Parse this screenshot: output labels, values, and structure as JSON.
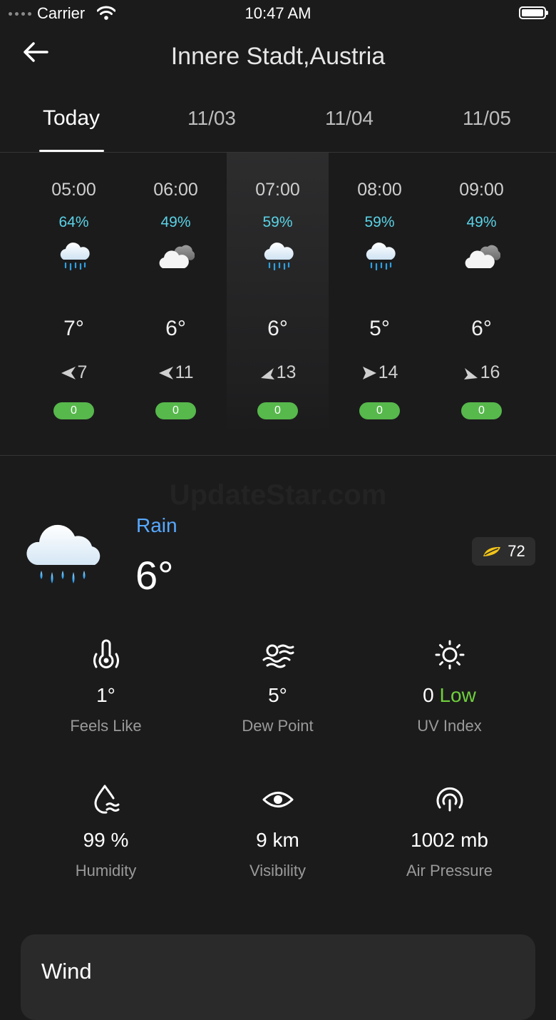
{
  "status_bar": {
    "carrier": "Carrier",
    "time": "10:47 AM"
  },
  "header": {
    "title": "Innere Stadt,Austria"
  },
  "tabs": [
    {
      "label": "Today",
      "active": true
    },
    {
      "label": "11/03"
    },
    {
      "label": "11/04"
    },
    {
      "label": "11/05"
    }
  ],
  "hourly": [
    {
      "time": "05:00",
      "precip": "64%",
      "icon": "rain-cloud-icon",
      "temp": "7°",
      "wind_dir": "west",
      "wind_speed": "7",
      "aqi": "0"
    },
    {
      "time": "06:00",
      "precip": "49%",
      "icon": "overcast-cloud-icon",
      "temp": "6°",
      "wind_dir": "west",
      "wind_speed": "11",
      "aqi": "0"
    },
    {
      "time": "07:00",
      "precip": "59%",
      "icon": "rain-cloud-icon",
      "temp": "6°",
      "wind_dir": "north-west",
      "wind_speed": "13",
      "aqi": "0",
      "selected": true
    },
    {
      "time": "08:00",
      "precip": "59%",
      "icon": "rain-cloud-icon",
      "temp": "5°",
      "wind_dir": "east",
      "wind_speed": "14",
      "aqi": "0"
    },
    {
      "time": "09:00",
      "precip": "49%",
      "icon": "overcast-cloud-icon",
      "temp": "6°",
      "wind_dir": "south-east",
      "wind_speed": "16",
      "aqi": "0"
    }
  ],
  "watermark": "UpdateStar.com",
  "current": {
    "condition": "Rain",
    "temp": "6°",
    "aqi": "72"
  },
  "details": {
    "feels_like": {
      "value": "1°",
      "label": "Feels Like"
    },
    "dew_point": {
      "value": "5°",
      "label": "Dew Point"
    },
    "uv_index": {
      "value": "0",
      "level": "Low",
      "label": "UV Index"
    },
    "humidity": {
      "value": "99 %",
      "label": "Humidity"
    },
    "visibility": {
      "value": "9 km",
      "label": "Visibility"
    },
    "air_pressure": {
      "value": "1002 mb",
      "label": "Air Pressure"
    }
  },
  "wind_card": {
    "title": "Wind"
  },
  "colors": {
    "background": "#1b1b1c",
    "precip": "#5ad3e6",
    "aqi_green": "#57b84c",
    "condition_blue": "#57a9ff",
    "uv_low": "#6fcf3c"
  }
}
